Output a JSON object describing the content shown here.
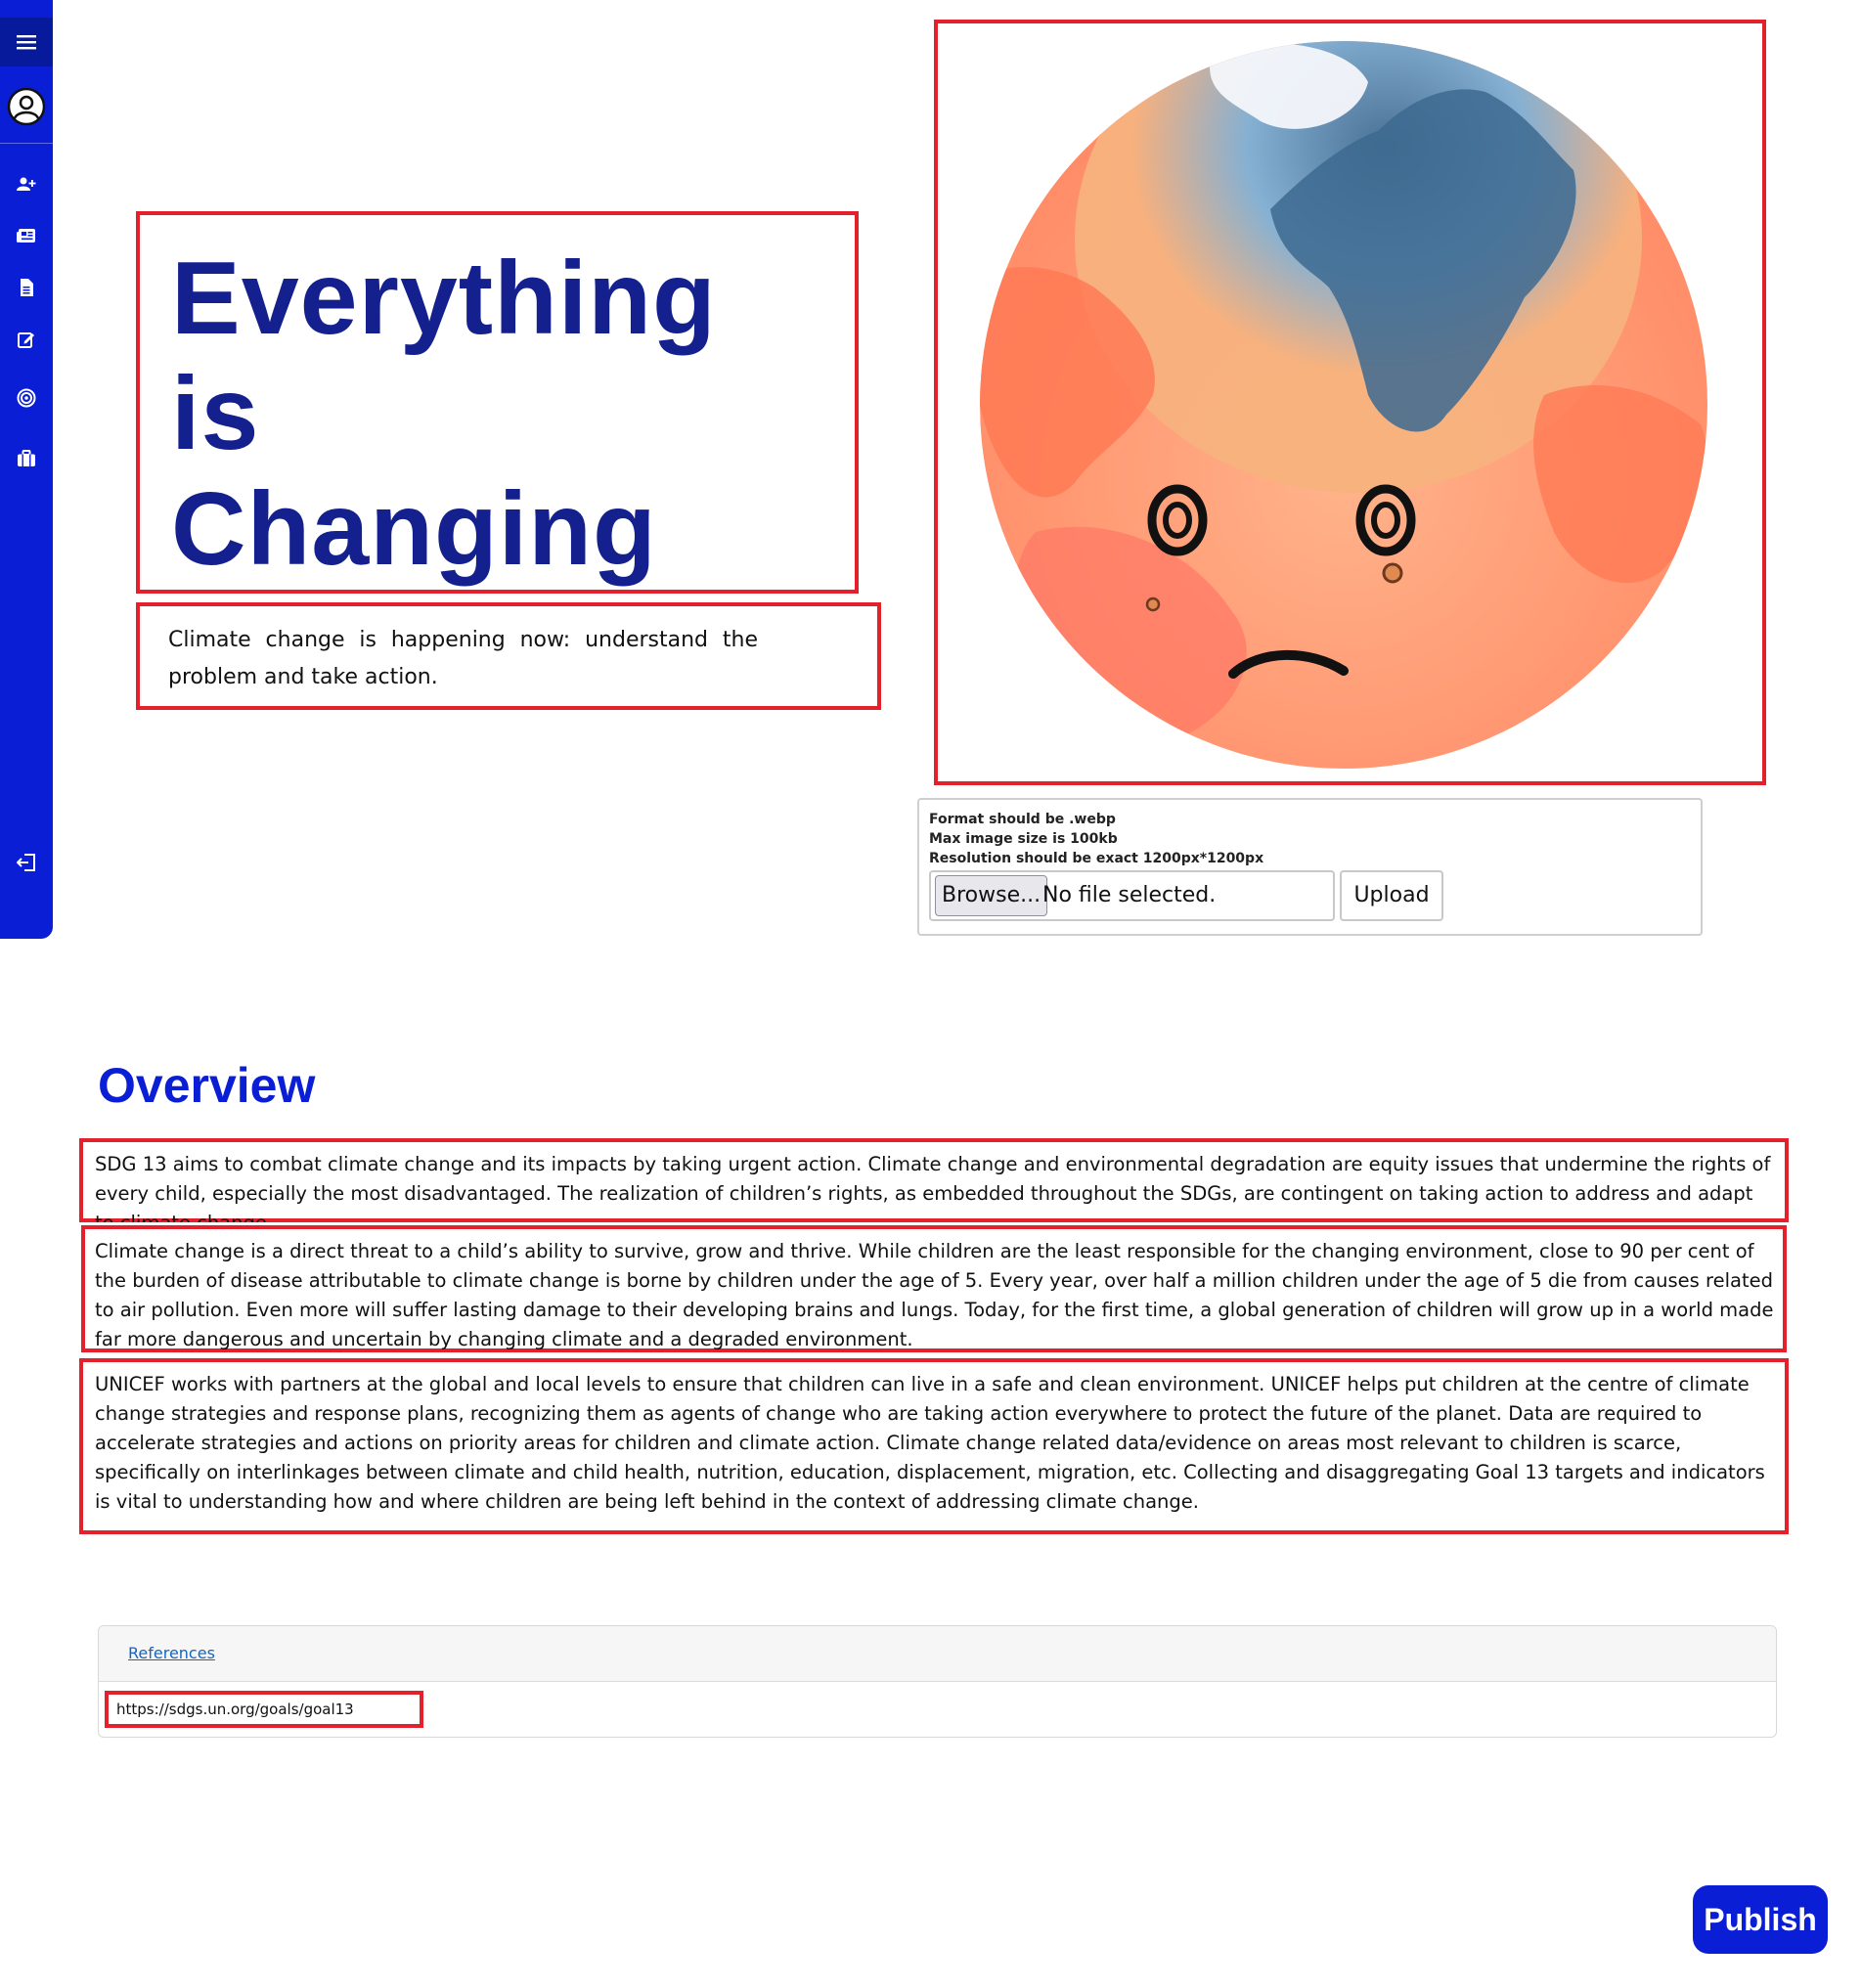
{
  "sidebar": {
    "icons": [
      "menu-icon",
      "user-avatar-icon",
      "add-user-icon",
      "news-icon",
      "document-icon",
      "edit-icon",
      "target-icon",
      "briefcase-icon",
      "logout-icon"
    ]
  },
  "hero": {
    "title_lines": [
      "Everything",
      "is",
      "Changing"
    ],
    "subtitle": "Climate change is happening now: understand the problem and take action."
  },
  "upload": {
    "hints": [
      "Format should be .webp",
      "Max image size is 100kb",
      "Resolution should be exact 1200px*1200px"
    ],
    "browse_label": "Browse...",
    "file_status": "No file selected.",
    "upload_label": "Upload"
  },
  "overview": {
    "title": "Overview",
    "paragraphs": [
      "SDG 13 aims to combat climate change and its impacts by taking urgent action. Climate change and environmental degradation are equity issues that undermine the rights of every child, especially the most disadvantaged. The realization of children’s rights, as embedded throughout the SDGs, are contingent on taking action to address and adapt to climate change.",
      "Climate change is a direct threat to a child’s ability to survive, grow and thrive. While children are the least responsible for the changing environment, close to 90 per cent of the burden of disease attributable to climate change is borne by children under the age of 5. Every year, over half a million children under the age of 5 die from causes related to air pollution. Even more will suffer lasting damage to their developing brains and lungs. Today, for the first time, a global generation of children will grow up in a world made far more dangerous and uncertain by changing climate and a degraded environment.",
      "UNICEF works with partners at the global and local levels to ensure that children can live in a safe and clean environment. UNICEF helps put children at the centre of climate change strategies and response plans, recognizing them as agents of change who are taking action everywhere to protect the future of the planet. Data are required to accelerate strategies and actions on priority areas for children and climate action. Climate change related data/evidence on areas most relevant to children is scarce, specifically on interlinkages between climate and child health, nutrition, education, displacement, migration, etc. Collecting and disaggregating Goal 13 targets and indicators is vital to understanding how and where children are being left behind in the context of addressing climate change."
    ]
  },
  "references": {
    "header_label": "References",
    "items": [
      "https://sdgs.un.org/goals/goal13"
    ]
  },
  "publish_label": "Publish",
  "colors": {
    "brand_blue": "#0a1ed6",
    "title_navy": "#15208f",
    "outline_red": "#e3202c"
  }
}
